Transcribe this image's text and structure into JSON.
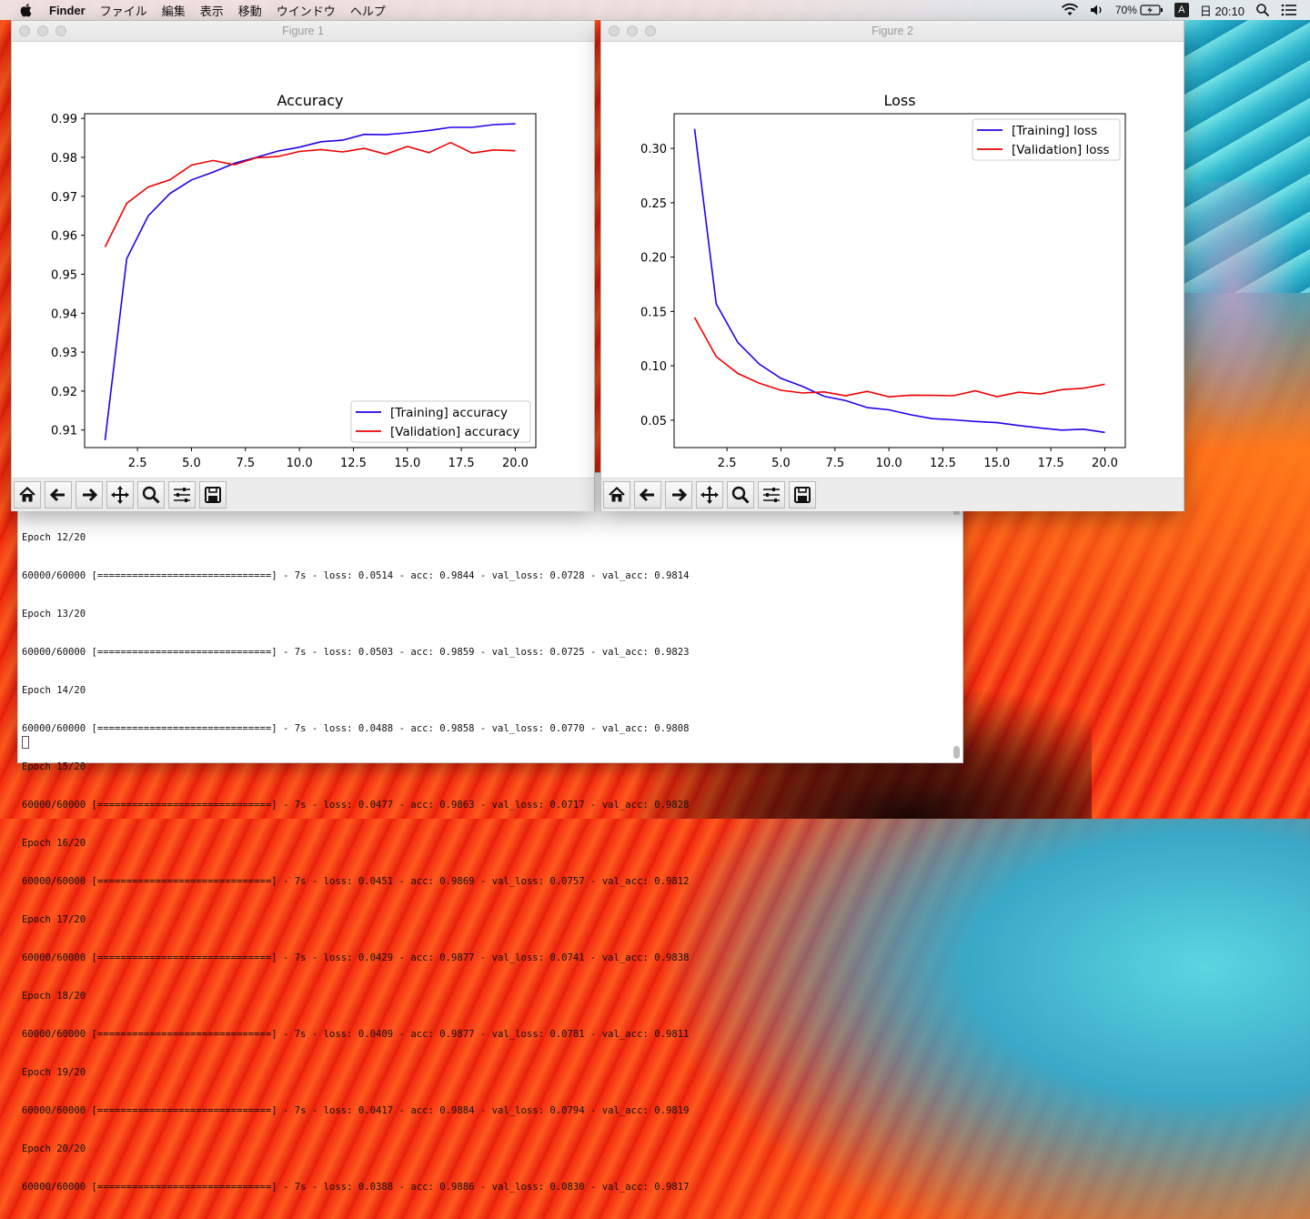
{
  "menubar": {
    "app": "Finder",
    "items": [
      "ファイル",
      "編集",
      "表示",
      "移動",
      "ウインドウ",
      "ヘルプ"
    ],
    "battery": "70%",
    "ime": "A",
    "clock": "日 20:10"
  },
  "terminal": {
    "lines": [
      "Epoch 12/20",
      "60000/60000 [==============================] - 7s - loss: 0.0514 - acc: 0.9844 - val_loss: 0.0728 - val_acc: 0.9814",
      "Epoch 13/20",
      "60000/60000 [==============================] - 7s - loss: 0.0503 - acc: 0.9859 - val_loss: 0.0725 - val_acc: 0.9823",
      "Epoch 14/20",
      "60000/60000 [==============================] - 7s - loss: 0.0488 - acc: 0.9858 - val_loss: 0.0770 - val_acc: 0.9808",
      "Epoch 15/20",
      "60000/60000 [==============================] - 7s - loss: 0.0477 - acc: 0.9863 - val_loss: 0.0717 - val_acc: 0.9828",
      "Epoch 16/20",
      "60000/60000 [==============================] - 7s - loss: 0.0451 - acc: 0.9869 - val_loss: 0.0757 - val_acc: 0.9812",
      "Epoch 17/20",
      "60000/60000 [==============================] - 7s - loss: 0.0429 - acc: 0.9877 - val_loss: 0.0741 - val_acc: 0.9838",
      "Epoch 18/20",
      "60000/60000 [==============================] - 7s - loss: 0.0409 - acc: 0.9877 - val_loss: 0.0781 - val_acc: 0.9811",
      "Epoch 19/20",
      "60000/60000 [==============================] - 7s - loss: 0.0417 - acc: 0.9884 - val_loss: 0.0794 - val_acc: 0.9819",
      "Epoch 20/20",
      "60000/60000 [==============================] - 7s - loss: 0.0388 - acc: 0.9886 - val_loss: 0.0830 - val_acc: 0.9817"
    ]
  },
  "figures": [
    {
      "window_title": "Figure 1"
    },
    {
      "window_title": "Figure 2"
    }
  ],
  "toolbar_icons": [
    "home-icon",
    "back-arrow-icon",
    "forward-arrow-icon",
    "pan-icon",
    "zoom-icon",
    "configure-subplots-icon",
    "save-icon"
  ],
  "colors": {
    "training": "#2200ee",
    "validation": "#ee0000"
  },
  "chart_data": [
    {
      "type": "line",
      "title": "Accuracy",
      "x": [
        1,
        2,
        3,
        4,
        5,
        6,
        7,
        8,
        9,
        10,
        11,
        12,
        13,
        14,
        15,
        16,
        17,
        18,
        19,
        20
      ],
      "xticks": [
        "2.5",
        "5.0",
        "7.5",
        "10.0",
        "12.5",
        "15.0",
        "17.5",
        "20.0"
      ],
      "yticks": [
        "0.91",
        "0.92",
        "0.93",
        "0.94",
        "0.95",
        "0.96",
        "0.97",
        "0.98",
        "0.99"
      ],
      "xlim": [
        0.05,
        20.95
      ],
      "ylim": [
        0.9055,
        0.9912
      ],
      "legend_position": "lower-right",
      "series": [
        {
          "name": "[Training] accuracy",
          "values": [
            0.9074,
            0.954,
            0.965,
            0.9707,
            0.9742,
            0.9762,
            0.9785,
            0.98,
            0.9816,
            0.9826,
            0.984,
            0.9844,
            0.9859,
            0.9858,
            0.9863,
            0.9869,
            0.9877,
            0.9877,
            0.9884,
            0.9886
          ]
        },
        {
          "name": "[Validation] accuracy",
          "values": [
            0.957,
            0.9682,
            0.9724,
            0.9742,
            0.978,
            0.9792,
            0.9781,
            0.9799,
            0.9802,
            0.9815,
            0.982,
            0.9814,
            0.9823,
            0.9808,
            0.9828,
            0.9812,
            0.9838,
            0.9811,
            0.9819,
            0.9817
          ]
        }
      ]
    },
    {
      "type": "line",
      "title": "Loss",
      "x": [
        1,
        2,
        3,
        4,
        5,
        6,
        7,
        8,
        9,
        10,
        11,
        12,
        13,
        14,
        15,
        16,
        17,
        18,
        19,
        20
      ],
      "xticks": [
        "2.5",
        "5.0",
        "7.5",
        "10.0",
        "12.5",
        "15.0",
        "17.5",
        "20.0"
      ],
      "yticks": [
        "0.05",
        "0.10",
        "0.15",
        "0.20",
        "0.25",
        "0.30"
      ],
      "xlim": [
        0.05,
        20.95
      ],
      "ylim": [
        0.0248,
        0.3319
      ],
      "legend_position": "upper-right",
      "series": [
        {
          "name": "[Training] loss",
          "values": [
            0.318,
            0.157,
            0.1215,
            0.1015,
            0.0885,
            0.081,
            0.072,
            0.068,
            0.0615,
            0.0595,
            0.055,
            0.0514,
            0.0503,
            0.0488,
            0.0477,
            0.0451,
            0.0429,
            0.0409,
            0.0417,
            0.0388
          ]
        },
        {
          "name": "[Validation] loss",
          "values": [
            0.1445,
            0.1085,
            0.093,
            0.084,
            0.0775,
            0.075,
            0.076,
            0.0725,
            0.0765,
            0.0715,
            0.073,
            0.0728,
            0.0725,
            0.077,
            0.0717,
            0.0757,
            0.0741,
            0.0781,
            0.0794,
            0.083
          ]
        }
      ]
    }
  ]
}
